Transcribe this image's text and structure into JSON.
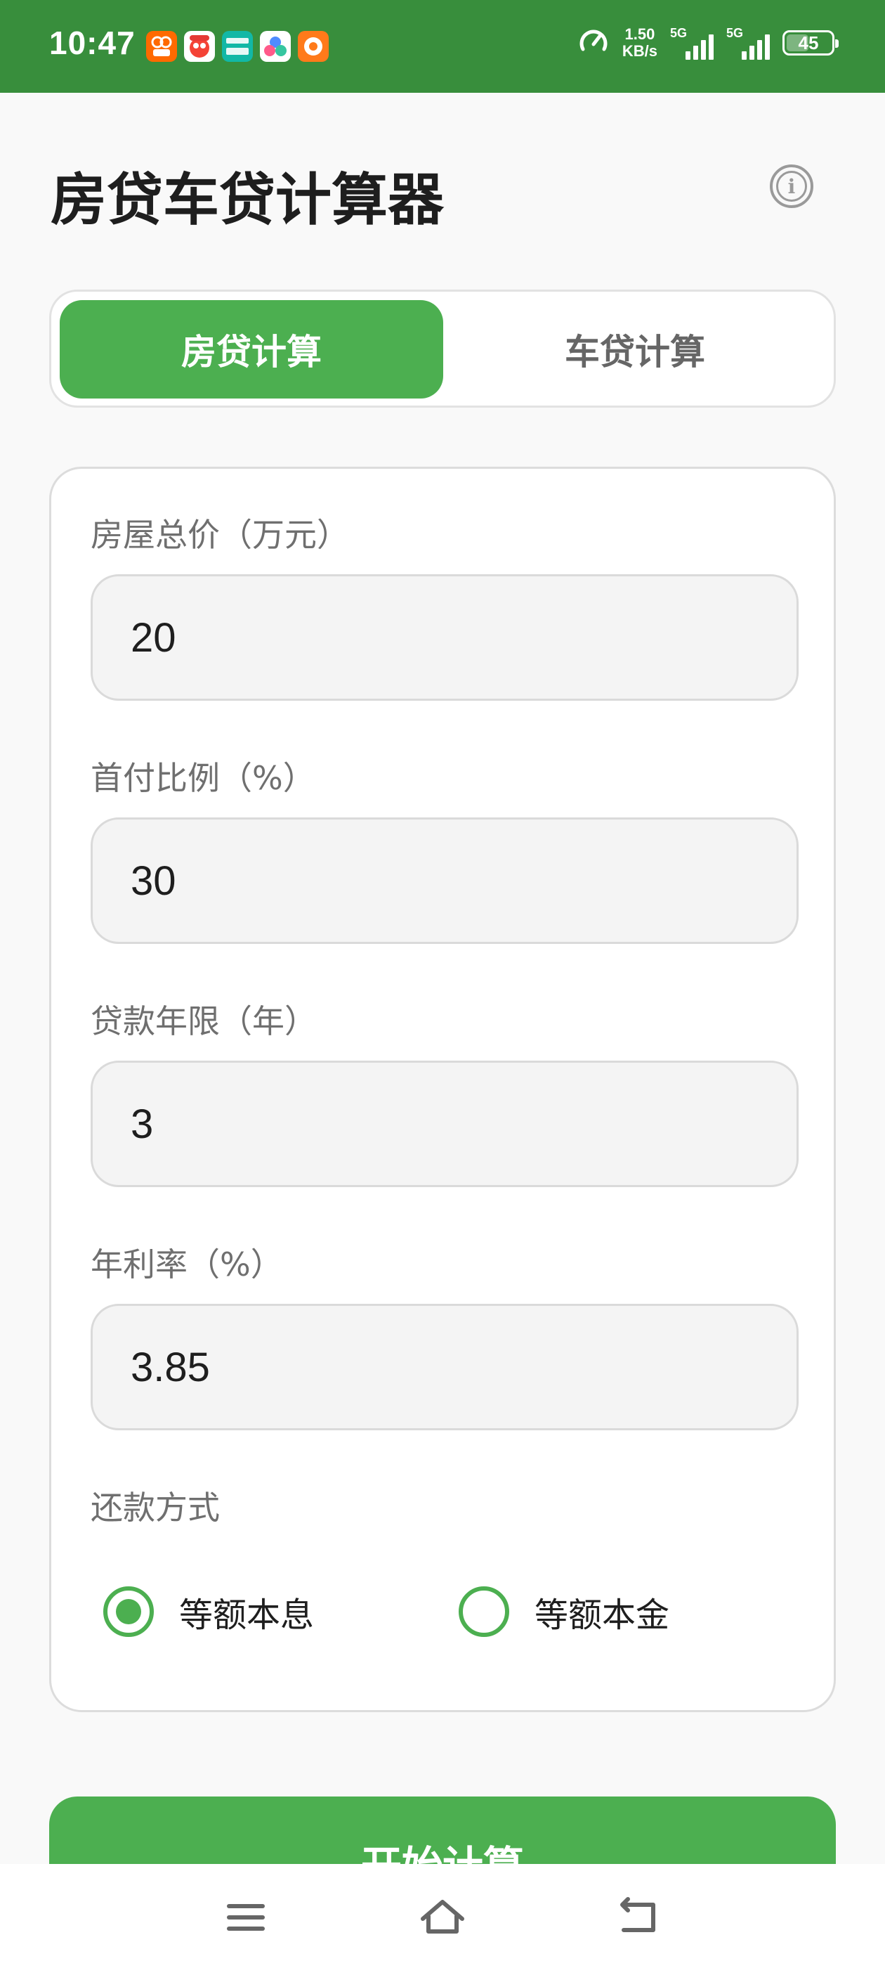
{
  "status_bar": {
    "time": "10:47",
    "net_speed_value": "1.50",
    "net_speed_unit": "KB/s",
    "sim1_label": "5G",
    "sim2_label": "5G",
    "battery": "45"
  },
  "header": {
    "title": "房贷车贷计算器"
  },
  "tabs": [
    {
      "label": "房贷计算",
      "active": true
    },
    {
      "label": "车贷计算",
      "active": false
    }
  ],
  "form": {
    "fields": [
      {
        "label": "房屋总价（万元）",
        "value": "20"
      },
      {
        "label": "首付比例（%）",
        "value": "30"
      },
      {
        "label": "贷款年限（年）",
        "value": "3"
      },
      {
        "label": "年利率（%）",
        "value": "3.85"
      }
    ],
    "repayment": {
      "label": "还款方式",
      "options": [
        {
          "label": "等额本息",
          "checked": true
        },
        {
          "label": "等额本金",
          "checked": false
        }
      ]
    }
  },
  "actions": {
    "calculate_label": "开始计算"
  },
  "colors": {
    "primary": "#4caf50",
    "status_bar": "#388e3c"
  },
  "icons": [
    "speed-gauge-icon",
    "info-icon",
    "menu-icon",
    "home-icon",
    "back-icon"
  ]
}
